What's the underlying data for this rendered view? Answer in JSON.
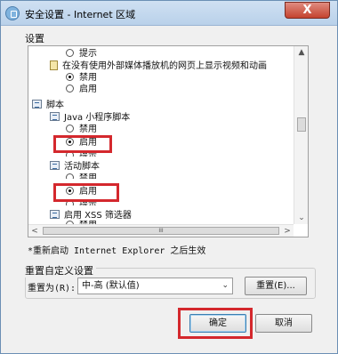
{
  "window": {
    "title": "安全设置 - Internet 区域",
    "close_glyph": "X"
  },
  "settings": {
    "label": "设置",
    "rows": [
      {
        "kind": "radio",
        "checked": false,
        "label": "提示"
      },
      {
        "kind": "doc",
        "label": "在没有使用外部媒体播放机的网页上显示视频和动画"
      },
      {
        "kind": "radio",
        "checked": true,
        "label": "禁用"
      },
      {
        "kind": "radio",
        "checked": false,
        "label": "启用"
      },
      {
        "kind": "script",
        "label": "脚本"
      },
      {
        "kind": "script",
        "label": "Java 小程序脚本"
      },
      {
        "kind": "radio",
        "checked": false,
        "label": "禁用"
      },
      {
        "kind": "radio",
        "checked": true,
        "label": "启用"
      },
      {
        "kind": "radio",
        "checked": false,
        "label": "提示"
      },
      {
        "kind": "script",
        "label": "活动脚本"
      },
      {
        "kind": "radio",
        "checked": false,
        "label": "禁用"
      },
      {
        "kind": "radio",
        "checked": true,
        "label": "启用"
      },
      {
        "kind": "radio",
        "checked": false,
        "label": "提示"
      },
      {
        "kind": "script",
        "label": "启用 XSS 筛选器"
      },
      {
        "kind": "radio",
        "checked": false,
        "label": "禁用"
      }
    ],
    "hscroll_thumb_label": "III"
  },
  "notice": "*重新启动 Internet Explorer 之后生效",
  "reset": {
    "group_label": "重置自定义设置",
    "field_label": "重置为(R):",
    "selected": "中-高 (默认值)",
    "button": "重置(E)..."
  },
  "footer": {
    "ok": "确定",
    "cancel": "取消"
  },
  "colors": {
    "highlight": "#d4282d",
    "title_bar": "#c4d9ef",
    "close_button": "#c4432f"
  }
}
